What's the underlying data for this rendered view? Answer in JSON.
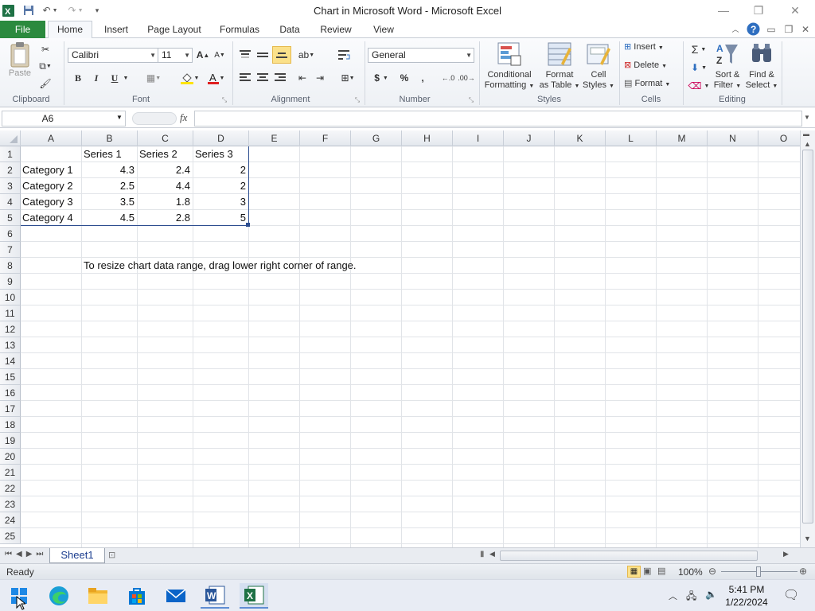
{
  "window": {
    "title": "Chart in Microsoft Word  -  Microsoft Excel"
  },
  "ribbon_tabs": [
    "File",
    "Home",
    "Insert",
    "Page Layout",
    "Formulas",
    "Data",
    "Review",
    "View"
  ],
  "clipboard": {
    "paste": "Paste",
    "group": "Clipboard"
  },
  "font": {
    "name": "Calibri",
    "size": "11",
    "group": "Font",
    "bold": "B",
    "italic": "I",
    "underline": "U"
  },
  "alignment": {
    "group": "Alignment"
  },
  "number": {
    "format": "General",
    "group": "Number",
    "currency": "$",
    "percent": "%",
    "comma": ","
  },
  "styles": {
    "conditional": "Conditional",
    "conditional2": "Formatting",
    "format_table": "Format",
    "format_table2": "as Table",
    "cell_styles": "Cell",
    "cell_styles2": "Styles",
    "group": "Styles"
  },
  "cells": {
    "insert": "Insert",
    "delete": "Delete",
    "format": "Format",
    "group": "Cells"
  },
  "editing": {
    "sort": "Sort &",
    "sort2": "Filter",
    "find": "Find &",
    "find2": "Select",
    "group": "Editing"
  },
  "formula_bar": {
    "name_box": "A6",
    "fx": "fx",
    "value": ""
  },
  "columns": [
    "A",
    "B",
    "C",
    "D",
    "E",
    "F",
    "G",
    "H",
    "I",
    "J",
    "K",
    "L",
    "M",
    "N",
    "O"
  ],
  "rows": [
    "1",
    "2",
    "3",
    "4",
    "5",
    "6",
    "7",
    "8",
    "9",
    "10",
    "11",
    "12",
    "13",
    "14",
    "15",
    "16",
    "17",
    "18",
    "19",
    "20",
    "21",
    "22",
    "23",
    "24",
    "25"
  ],
  "table": {
    "headers": [
      "Series 1",
      "Series 2",
      "Series 3"
    ],
    "rows": [
      {
        "label": "Category 1",
        "values": [
          "4.3",
          "2.4",
          "2"
        ]
      },
      {
        "label": "Category 2",
        "values": [
          "2.5",
          "4.4",
          "2"
        ]
      },
      {
        "label": "Category 3",
        "values": [
          "3.5",
          "1.8",
          "3"
        ]
      },
      {
        "label": "Category 4",
        "values": [
          "4.5",
          "2.8",
          "5"
        ]
      }
    ]
  },
  "note": "To resize chart data range, drag lower right corner of range.",
  "sheet_tab": "Sheet1",
  "status": {
    "ready": "Ready",
    "zoom": "100%"
  },
  "taskbar": {
    "time": "5:41 PM",
    "date": "1/22/2024"
  },
  "colors": {
    "file_tab": "#2b8a3e",
    "excel_green": "#1e7145",
    "selection_border": "#2c4d8f"
  }
}
